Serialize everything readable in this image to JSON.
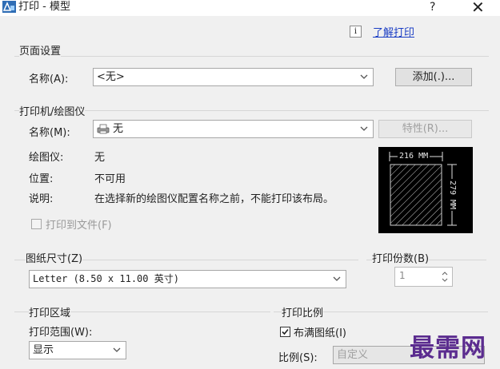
{
  "window": {
    "title": "打印 - 模型",
    "help_label": "?",
    "close_label": "✕"
  },
  "help_link": {
    "icon_glyph": "i",
    "label": "了解打印"
  },
  "page_setup": {
    "title": "页面设置",
    "name_label": "名称(A):",
    "name_value": "<无>",
    "add_button": "添加(.)..."
  },
  "plotter": {
    "title": "打印机/绘图仪",
    "name_label": "名称(M):",
    "name_value": "无",
    "properties_button": "特性(R)...",
    "device_label": "绘图仪:",
    "device_value": "无",
    "location_label": "位置:",
    "location_value": "不可用",
    "description_label": "说明:",
    "description_value": "在选择新的绘图仪配置名称之前，不能打印该布局。",
    "plot_to_file_label": "打印到文件(F)",
    "plot_to_file_checked": false
  },
  "preview": {
    "width_label": "216 MM",
    "height_label": "279 MM"
  },
  "paper_size": {
    "title": "图纸尺寸(Z)",
    "value": "Letter (8.50 x 11.00 英寸)"
  },
  "copies": {
    "title": "打印份数(B)",
    "value": "1"
  },
  "plot_area": {
    "title": "打印区域",
    "range_label": "打印范围(W):",
    "range_value": "显示"
  },
  "plot_scale": {
    "title": "打印比例",
    "fit_label": "布满图纸(I)",
    "fit_checked": true,
    "scale_label": "比例(S):",
    "scale_value": "自定义"
  },
  "watermark": {
    "text": "最需网"
  },
  "colors": {
    "link": "#1a3dc4",
    "preview_bg": "#000000",
    "watermark": "#5b2c8f"
  }
}
